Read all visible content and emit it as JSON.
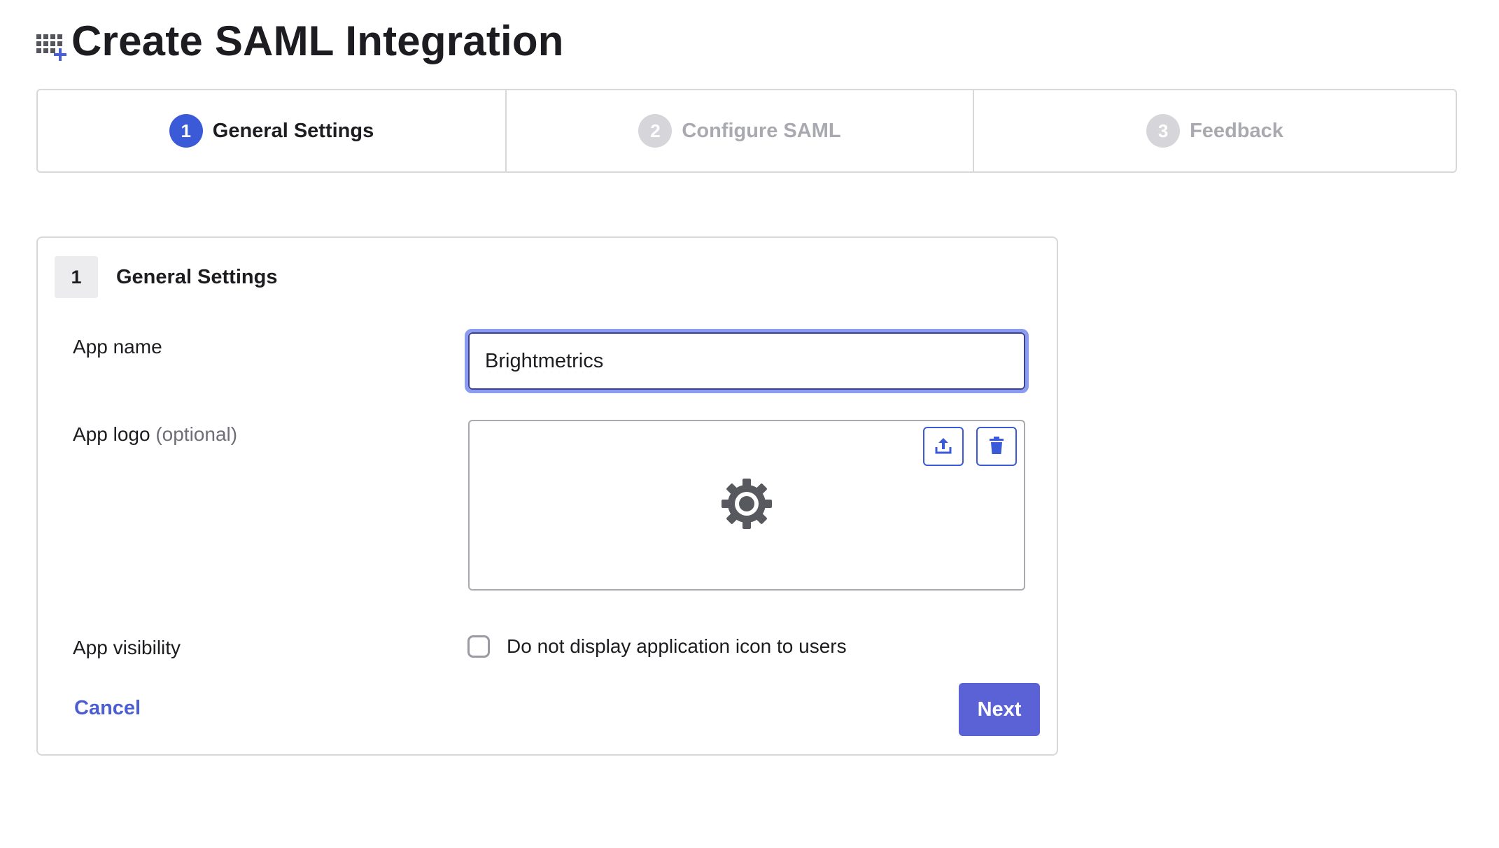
{
  "header": {
    "title": "Create SAML Integration",
    "icon": "app-grid-add-icon"
  },
  "stepper": {
    "steps": [
      {
        "number": "1",
        "label": "General Settings",
        "active": true
      },
      {
        "number": "2",
        "label": "Configure SAML",
        "active": false
      },
      {
        "number": "3",
        "label": "Feedback",
        "active": false
      }
    ]
  },
  "form": {
    "section_number": "1",
    "section_title": "General Settings",
    "app_name": {
      "label": "App name",
      "value": "Brightmetrics"
    },
    "app_logo": {
      "label": "App logo",
      "optional": "(optional)",
      "placeholder_icon": "gear-icon",
      "upload_icon": "upload-icon",
      "delete_icon": "trash-icon"
    },
    "app_visibility": {
      "label": "App visibility",
      "checkbox_label": "Do not display application icon to users",
      "checked": false
    },
    "cancel_label": "Cancel",
    "next_label": "Next"
  },
  "colors": {
    "accent": "#3a5ad8",
    "primary_button": "#5a62d6",
    "inactive_step": "#d6d6da",
    "border": "#d7d7dc"
  }
}
